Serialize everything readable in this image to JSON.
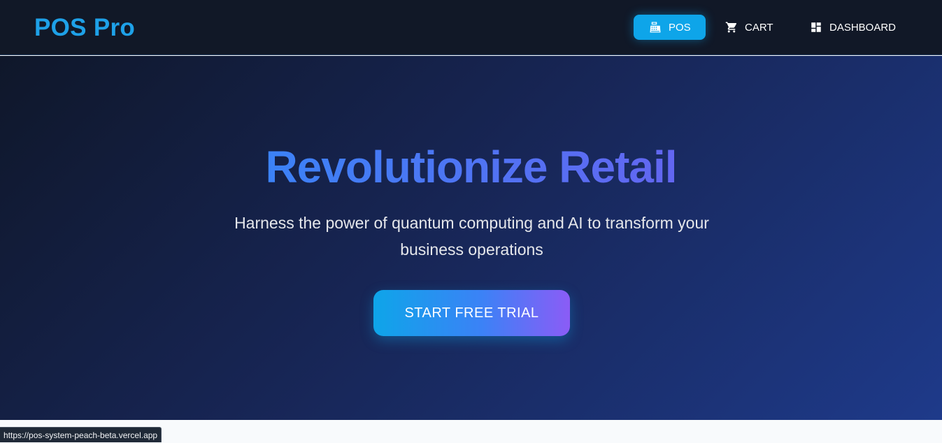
{
  "brand": {
    "name": "POS Pro",
    "color": "#1ea1e8"
  },
  "nav": {
    "items": [
      {
        "label": "POS",
        "icon": "cash-register-icon",
        "active": true
      },
      {
        "label": "CART",
        "icon": "cart-icon",
        "active": false
      },
      {
        "label": "DASHBOARD",
        "icon": "dashboard-icon",
        "active": false
      }
    ],
    "active_color": "#0ea5e9"
  },
  "hero": {
    "title": "Revolutionize Retail",
    "subtitle": "Harness the power of quantum computing and AI to transform your business operations",
    "cta_label": "START FREE TRIAL"
  },
  "status_bar": {
    "url": "https://pos-system-peach-beta.vercel.app"
  }
}
